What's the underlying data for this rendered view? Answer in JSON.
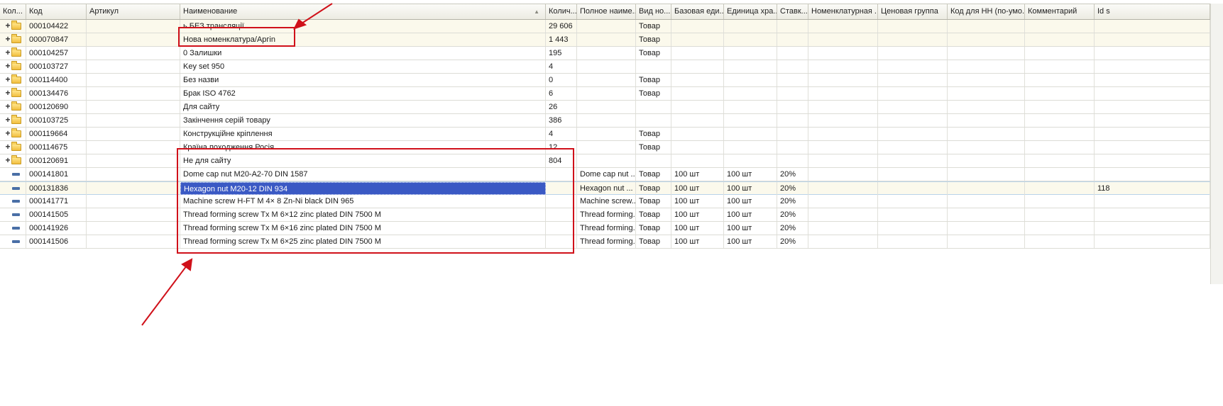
{
  "table": {
    "columns": [
      {
        "label": "Кол...",
        "sort": ""
      },
      {
        "label": "Код",
        "sort": ""
      },
      {
        "label": "Артикул",
        "sort": ""
      },
      {
        "label": "Наименование",
        "sort": "▲"
      },
      {
        "label": "Колич...",
        "sort": ""
      },
      {
        "label": "Полное наиме...",
        "sort": ""
      },
      {
        "label": "Вид но...",
        "sort": ""
      },
      {
        "label": "Базовая еди...",
        "sort": ""
      },
      {
        "label": "Единица хра...",
        "sort": ""
      },
      {
        "label": "Ставк...",
        "sort": ""
      },
      {
        "label": "Номенклатурная ...",
        "sort": ""
      },
      {
        "label": "Ценовая группа",
        "sort": ""
      },
      {
        "label": "Код для НН (по-умо...",
        "sort": ""
      },
      {
        "label": "Комментарий",
        "sort": ""
      },
      {
        "label": "Id s",
        "sort": ""
      }
    ],
    "rows": [
      {
        "kind": "group",
        "expander": "+",
        "cells": [
          "",
          "000104422",
          "",
          "ь БЕЗ трансляції",
          "29 606",
          "",
          "Товар",
          "",
          "",
          "",
          "",
          "",
          "",
          "",
          ""
        ]
      },
      {
        "kind": "group",
        "expander": "+",
        "cells": [
          "",
          "000070847",
          "",
          "Нова номенклатура/Apгin",
          "1 443",
          "",
          "Товар",
          "",
          "",
          "",
          "",
          "",
          "",
          "",
          ""
        ]
      },
      {
        "kind": "plain",
        "expander": "+",
        "cells": [
          "",
          "000104257",
          "",
          "0 Залишки",
          "195",
          "",
          "Товар",
          "",
          "",
          "",
          "",
          "",
          "",
          "",
          ""
        ]
      },
      {
        "kind": "plain",
        "expander": "+",
        "cells": [
          "",
          "000103727",
          "",
          "Key set 950",
          "4",
          "",
          "",
          "",
          "",
          "",
          "",
          "",
          "",
          "",
          ""
        ]
      },
      {
        "kind": "plain",
        "expander": "+",
        "cells": [
          "",
          "000114400",
          "",
          "Без назви",
          "0",
          "",
          "Товар",
          "",
          "",
          "",
          "",
          "",
          "",
          "",
          ""
        ]
      },
      {
        "kind": "plain",
        "expander": "+",
        "cells": [
          "",
          "000134476",
          "",
          "Брак ISO 4762",
          "6",
          "",
          "Товар",
          "",
          "",
          "",
          "",
          "",
          "",
          "",
          ""
        ]
      },
      {
        "kind": "plain",
        "expander": "+",
        "cells": [
          "",
          "000120690",
          "",
          "Для сайту",
          "26",
          "",
          "",
          "",
          "",
          "",
          "",
          "",
          "",
          "",
          ""
        ]
      },
      {
        "kind": "plain",
        "expander": "+",
        "cells": [
          "",
          "000103725",
          "",
          "Закінчення серій товару",
          "386",
          "",
          "",
          "",
          "",
          "",
          "",
          "",
          "",
          "",
          ""
        ]
      },
      {
        "kind": "plain",
        "expander": "+",
        "cells": [
          "",
          "000119664",
          "",
          "Конструкційне кріплення",
          "4",
          "",
          "Товар",
          "",
          "",
          "",
          "",
          "",
          "",
          "",
          ""
        ]
      },
      {
        "kind": "plain",
        "expander": "+",
        "cells": [
          "",
          "000114675",
          "",
          "Країна походження Росія",
          "12",
          "",
          "Товар",
          "",
          "",
          "",
          "",
          "",
          "",
          "",
          ""
        ]
      },
      {
        "kind": "plain",
        "expander": "+",
        "cells": [
          "",
          "000120691",
          "",
          "Не для сайту",
          "804",
          "",
          "",
          "",
          "",
          "",
          "",
          "",
          "",
          "",
          ""
        ]
      },
      {
        "kind": "item",
        "expander": "",
        "cells": [
          "",
          "000141801",
          "",
          "Dome cap nut  M20-A2-70   DIN 1587",
          "",
          "Dome cap nut  ...",
          "Товар",
          "100 шт",
          "100 шт",
          "20%",
          "",
          "",
          "",
          "",
          ""
        ]
      },
      {
        "kind": "item",
        "expander": "",
        "current": true,
        "cells": [
          "",
          "000131836",
          "",
          "Hexagon nut  M20-12   DIN 934",
          "",
          "Hexagon nut  ...",
          "Товар",
          "100 шт",
          "100 шт",
          "20%",
          "",
          "",
          "",
          "",
          "118"
        ]
      },
      {
        "kind": "item",
        "expander": "",
        "cells": [
          "",
          "000141771",
          "",
          "Machine screw  H-FT M 4× 8  Zn-Ni black  DIN 965",
          "",
          "Machine screw...",
          "Товар",
          "100 шт",
          "100 шт",
          "20%",
          "",
          "",
          "",
          "",
          ""
        ]
      },
      {
        "kind": "item",
        "expander": "",
        "cells": [
          "",
          "000141505",
          "",
          "Thread forming screw  Tx M 6×12  zinc plated  DIN 7500 M",
          "",
          "Thread forming...",
          "Товар",
          "100 шт",
          "100 шт",
          "20%",
          "",
          "",
          "",
          "",
          ""
        ]
      },
      {
        "kind": "item",
        "expander": "",
        "cells": [
          "",
          "000141926",
          "",
          "Thread forming screw  Tx M 6×16  zinc plated  DIN 7500 M",
          "",
          "Thread forming...",
          "Товар",
          "100 шт",
          "100 шт",
          "20%",
          "",
          "",
          "",
          "",
          ""
        ]
      },
      {
        "kind": "item",
        "expander": "",
        "cells": [
          "",
          "000141506",
          "",
          "Thread forming screw  Tx M 6×25  zinc plated  DIN 7500 M",
          "",
          "Thread forming...",
          "Товар",
          "100 шт",
          "100 шт",
          "20%",
          "",
          "",
          "",
          "",
          ""
        ]
      }
    ]
  },
  "colors": {
    "annotation": "#d0111a",
    "selection": "#3a59c4",
    "group_row": "#fbf9ec"
  }
}
